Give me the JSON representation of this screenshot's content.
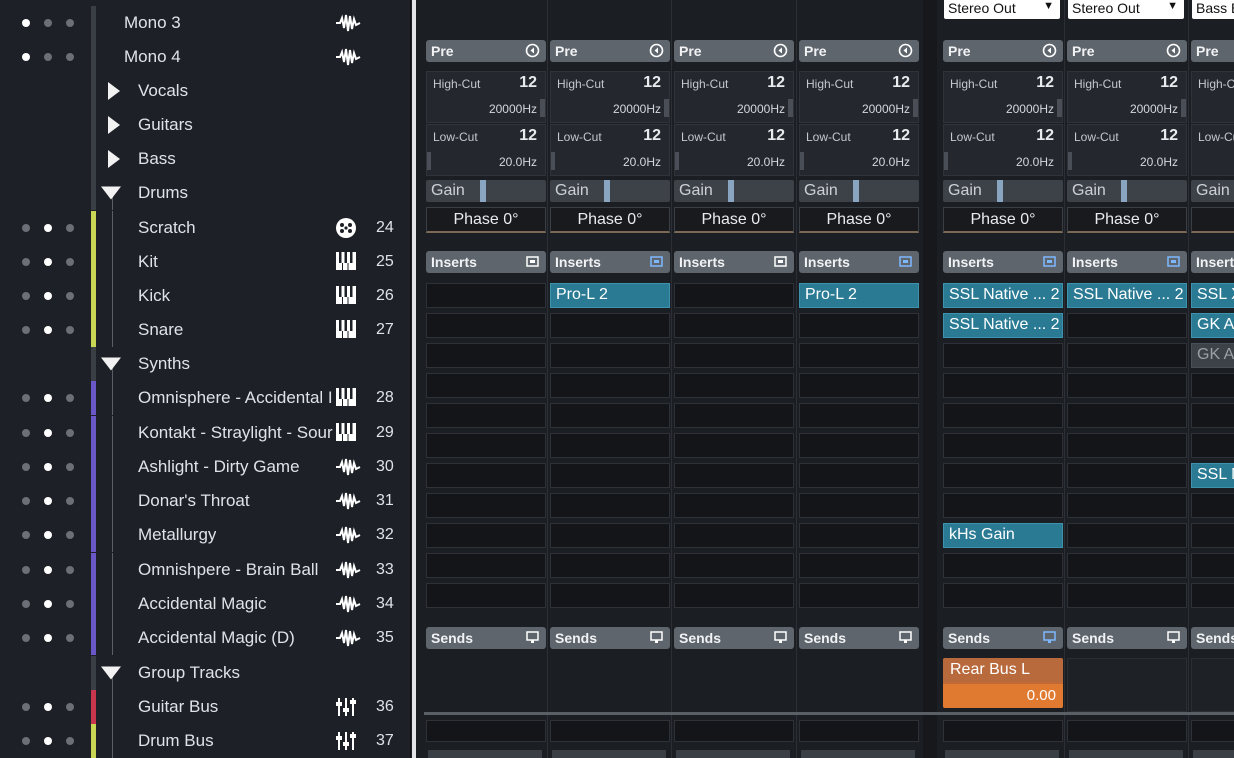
{
  "tracks": [
    {
      "name": "Mono 3",
      "kind": "track",
      "dots": [
        true,
        false,
        false
      ],
      "color": "#3a3e45",
      "icon": "audio-wave-icon",
      "number": ""
    },
    {
      "name": "Mono 4",
      "kind": "track",
      "dots": [
        true,
        false,
        false
      ],
      "color": "#3a3e45",
      "icon": "audio-wave-icon",
      "number": ""
    },
    {
      "name": "Vocals",
      "kind": "folder-closed",
      "color": "#3a3e45"
    },
    {
      "name": "Guitars",
      "kind": "folder-closed",
      "color": "#3a3e45"
    },
    {
      "name": "Bass",
      "kind": "folder-closed",
      "color": "#3a3e45"
    },
    {
      "name": "Drums",
      "kind": "folder-open",
      "color": "#3a3e45"
    },
    {
      "name": "Scratch",
      "kind": "child",
      "dots": [
        false,
        true,
        false
      ],
      "color": "#c9d653",
      "icon": "drum-machine-icon",
      "number": "24"
    },
    {
      "name": "Kit",
      "kind": "child",
      "dots": [
        false,
        true,
        false
      ],
      "color": "#c9d653",
      "icon": "piano-keys-icon",
      "number": "25"
    },
    {
      "name": "Kick",
      "kind": "child",
      "dots": [
        false,
        true,
        false
      ],
      "color": "#c9d653",
      "icon": "piano-keys-icon",
      "number": "26"
    },
    {
      "name": "Snare",
      "kind": "child",
      "dots": [
        false,
        true,
        false
      ],
      "color": "#c9d653",
      "icon": "piano-keys-icon",
      "number": "27"
    },
    {
      "name": "Synths",
      "kind": "folder-open",
      "color": "#3a3e45"
    },
    {
      "name": "Omnisphere - Accidental I",
      "kind": "child",
      "dots": [
        false,
        true,
        false
      ],
      "color": "#6a58c8",
      "icon": "piano-keys-icon",
      "number": "28"
    },
    {
      "name": "Kontakt - Straylight - Sour",
      "kind": "child",
      "dots": [
        false,
        true,
        false
      ],
      "color": "#6a58c8",
      "icon": "piano-keys-icon",
      "number": "29"
    },
    {
      "name": "Ashlight - Dirty Game",
      "kind": "child",
      "dots": [
        false,
        true,
        false
      ],
      "color": "#6a58c8",
      "icon": "audio-wave-icon",
      "number": "30"
    },
    {
      "name": "Donar's Throat",
      "kind": "child",
      "dots": [
        false,
        true,
        false
      ],
      "color": "#6a58c8",
      "icon": "audio-wave-icon",
      "number": "31"
    },
    {
      "name": "Metallurgy",
      "kind": "child",
      "dots": [
        false,
        true,
        false
      ],
      "color": "#6a58c8",
      "icon": "audio-wave-icon",
      "number": "32"
    },
    {
      "name": "Omnishpere - Brain Ball",
      "kind": "child",
      "dots": [
        false,
        true,
        false
      ],
      "color": "#6a58c8",
      "icon": "audio-wave-icon",
      "number": "33"
    },
    {
      "name": "Accidental Magic",
      "kind": "child",
      "dots": [
        false,
        true,
        false
      ],
      "color": "#6a58c8",
      "icon": "audio-wave-icon",
      "number": "34"
    },
    {
      "name": "Accidental Magic (D)",
      "kind": "child",
      "dots": [
        false,
        true,
        false
      ],
      "color": "#6a58c8",
      "icon": "audio-wave-icon",
      "number": "35"
    },
    {
      "name": "Group Tracks",
      "kind": "folder-open",
      "color": "#3a3e45"
    },
    {
      "name": "Guitar Bus",
      "kind": "child",
      "dots": [
        false,
        true,
        false
      ],
      "color": "#c8364e",
      "icon": "group-faders-icon",
      "number": "36"
    },
    {
      "name": "Drum Bus",
      "kind": "child",
      "dots": [
        false,
        true,
        false
      ],
      "color": "#c9d653",
      "icon": "group-faders-icon",
      "number": "37"
    }
  ],
  "mixer": {
    "pre_label": "Pre",
    "highcut_label": "High-Cut",
    "lowcut_label": "Low-Cut",
    "badge": "12",
    "gain_label": "Gain",
    "inserts_label": "Inserts",
    "sends_label": "Sends",
    "channels": [
      {
        "output": "",
        "highcut": "20000Hz",
        "lowcut": "20.0Hz",
        "gain": 0.45,
        "phase": "Phase 0°",
        "inserts": [],
        "send": null
      },
      {
        "output": "",
        "highcut": "20000Hz",
        "lowcut": "20.0Hz",
        "gain": 0.45,
        "phase": "Phase 0°",
        "inserts": [
          "Pro-L 2"
        ],
        "send": null
      },
      {
        "output": "",
        "highcut": "20000Hz",
        "lowcut": "20.0Hz",
        "gain": 0.45,
        "phase": "Phase 0°",
        "inserts": [],
        "send": null
      },
      {
        "output": "",
        "highcut": "20000Hz",
        "lowcut": "20.0Hz",
        "gain": 0.45,
        "phase": "Phase 0°",
        "inserts": [
          "Pro-L 2"
        ],
        "send": null
      },
      {
        "output": "Stereo Out",
        "highcut": "20000Hz",
        "lowcut": "20.0Hz",
        "gain": 0.45,
        "phase": "Phase 0°",
        "inserts": [
          "SSL Native ... 2",
          "SSL Native ... 2",
          "",
          "",
          "",
          "",
          "",
          "",
          "kHs Gain"
        ],
        "send": {
          "name": "Rear Bus L",
          "value": "0.00"
        }
      },
      {
        "output": "Stereo Out",
        "highcut": "20000Hz",
        "lowcut": "20.0Hz",
        "gain": 0.45,
        "phase": "Phase 0°",
        "inserts": [
          "SSL Native ... 2"
        ],
        "send": null
      },
      {
        "output": "Bass B",
        "highcut": "",
        "lowcut": "",
        "gain": 0.45,
        "phase": "Ph",
        "inserts": [
          "SSL X",
          "GK A",
          "GK A",
          "",
          "",
          "",
          "SSL N"
        ],
        "send": null
      }
    ]
  }
}
